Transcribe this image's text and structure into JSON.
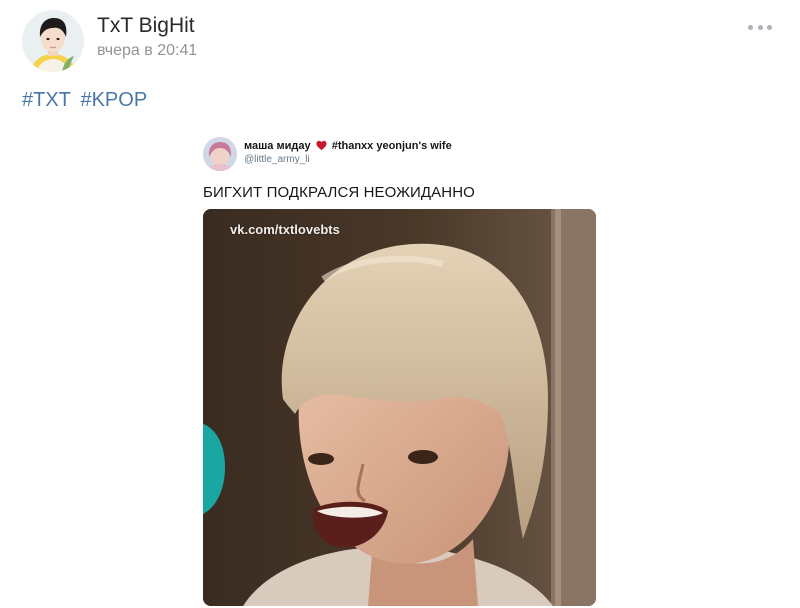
{
  "post": {
    "author": "TxT BigHit",
    "time": "вчера в 20:41",
    "hashtags": [
      "#TXT",
      "#KPOP"
    ],
    "more_icon": "more-horizontal-icon"
  },
  "tweet": {
    "display_name": "маша мидау",
    "heart_icon": "red-heart-icon",
    "bio_tag": "#thanxx yeonjun's wife",
    "handle": "@little_army_li",
    "text": "БИГХИТ ПОДКРАЛСЯ НЕОЖИДАННО",
    "watermark": "vk.com/txtlovebts"
  },
  "colors": {
    "link": "#4a76a8",
    "author": "#2a2a2a",
    "meta": "#939393"
  }
}
